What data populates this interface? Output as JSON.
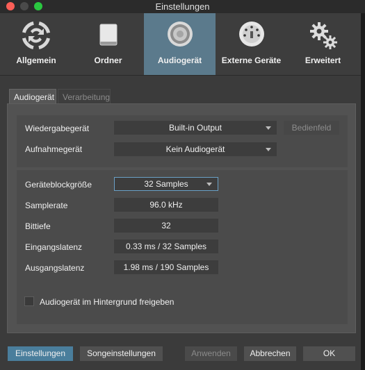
{
  "window": {
    "title": "Einstellungen"
  },
  "toolbar": {
    "items": [
      {
        "label": "Allgemein",
        "icon": "sync-icon"
      },
      {
        "label": "Ordner",
        "icon": "drive-icon"
      },
      {
        "label": "Audiogerät",
        "icon": "speaker-icon",
        "active": true
      },
      {
        "label": "Externe Geräte",
        "icon": "midi-connector-icon"
      },
      {
        "label": "Erweitert",
        "icon": "gears-icon"
      }
    ]
  },
  "tabs": [
    {
      "label": "Audiogerät",
      "active": true
    },
    {
      "label": "Verarbeitung",
      "active": false
    }
  ],
  "device": {
    "playback_label": "Wiedergabegerät",
    "playback_value": "Built-in Output",
    "control_panel_button": "Bedienfeld",
    "record_label": "Aufnahmegerät",
    "record_value": "Kein Audiogerät"
  },
  "settings": {
    "block_size_label": "Geräteblockgröße",
    "block_size_value": "32 Samples",
    "samplerate_label": "Samplerate",
    "samplerate_value": "96.0 kHz",
    "bitdepth_label": "Bittiefe",
    "bitdepth_value": "32",
    "input_latency_label": "Eingangslatenz",
    "input_latency_value": "0.33 ms / 32 Samples",
    "output_latency_label": "Ausgangslatenz",
    "output_latency_value": "1.98 ms / 190 Samples",
    "background_checkbox_label": "Audiogerät im Hintergrund freigeben",
    "background_checked": false
  },
  "footer": {
    "settings_button": "Einstellungen",
    "song_settings_button": "Songeinstellungen",
    "apply_button": "Anwenden",
    "cancel_button": "Abbrechen",
    "ok_button": "OK"
  },
  "colors": {
    "accent": "#4a7e9c",
    "active_tab": "#5b7a8c",
    "focus": "#6aa1c7"
  }
}
